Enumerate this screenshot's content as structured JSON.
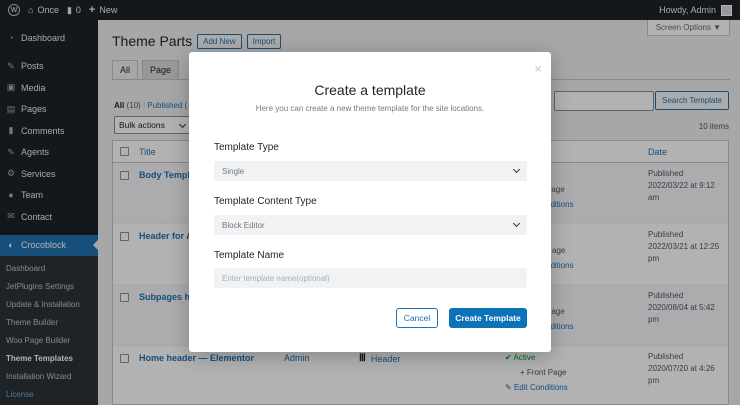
{
  "admin_bar": {
    "site_name": "Once",
    "comments_count": "0",
    "new_label": "New",
    "howdy": "Howdy, Admin"
  },
  "sidebar": {
    "items": [
      {
        "label": "Dashboard",
        "icon": "dashboard-icon"
      },
      {
        "label": "Posts",
        "icon": "pin-icon"
      },
      {
        "label": "Media",
        "icon": "media-icon"
      },
      {
        "label": "Pages",
        "icon": "page-icon"
      },
      {
        "label": "Comments",
        "icon": "comment-icon"
      },
      {
        "label": "Agents",
        "icon": "pin-icon"
      },
      {
        "label": "Services",
        "icon": "gear-icon"
      },
      {
        "label": "Team",
        "icon": "user-icon"
      },
      {
        "label": "Contact",
        "icon": "mail-icon"
      }
    ],
    "active": {
      "label": "Crocoblock",
      "icon": "crocoblock-icon"
    },
    "submenu": [
      "Dashboard",
      "JetPlugins Settings",
      "Update & Installation",
      "Theme Builder",
      "Woo Page Builder",
      "Theme Templates",
      "Installation Wizard",
      "License"
    ]
  },
  "main": {
    "screen_options": "Screen Options ▼",
    "title": "Theme Parts",
    "add_new": "Add New",
    "import": "Import",
    "tabs": [
      "All",
      "Page"
    ],
    "subsubsub_all": "All",
    "subsubsub_all_count": "(10)",
    "subsubsub_published": "Published (",
    "search_button": "Search Template",
    "bulk_actions": "Bulk actions",
    "items_count": "10 items",
    "columns": {
      "title": "Title",
      "date": "Date"
    },
    "rows": [
      {
        "title": "Body Templ",
        "author": "",
        "type": "",
        "status": "",
        "front": "Page",
        "edit": "nditions",
        "date": "Published\n2022/03/22 at 9:12 am"
      },
      {
        "title": "Header for A",
        "author": "",
        "type": "",
        "status": "",
        "front": "age",
        "edit": "nditions",
        "date": "Published\n2022/03/21 at 12:25 pm"
      },
      {
        "title": "Subpages he",
        "author": "",
        "type": "",
        "status": "",
        "front": "Page",
        "edit": "nditions",
        "date": "Published\n2020/08/04 at 5:42 pm"
      },
      {
        "title": "Home header — Elementor",
        "author": "Admin",
        "type": "Header",
        "status": "Active",
        "front": "+ Front Page",
        "edit": "Edit Conditions",
        "date": "Published\n2020/07/20 at 4:26 pm"
      }
    ]
  },
  "modal": {
    "title": "Create a template",
    "subtitle": "Here you can create a new theme template for the site locations.",
    "template_type_label": "Template Type",
    "template_type_value": "Single",
    "content_type_label": "Template Content Type",
    "content_type_value": "Block Editor",
    "name_label": "Template Name",
    "name_placeholder": "Enter template name(optional)",
    "cancel": "Cancel",
    "create": "Create Template",
    "close": "×"
  }
}
